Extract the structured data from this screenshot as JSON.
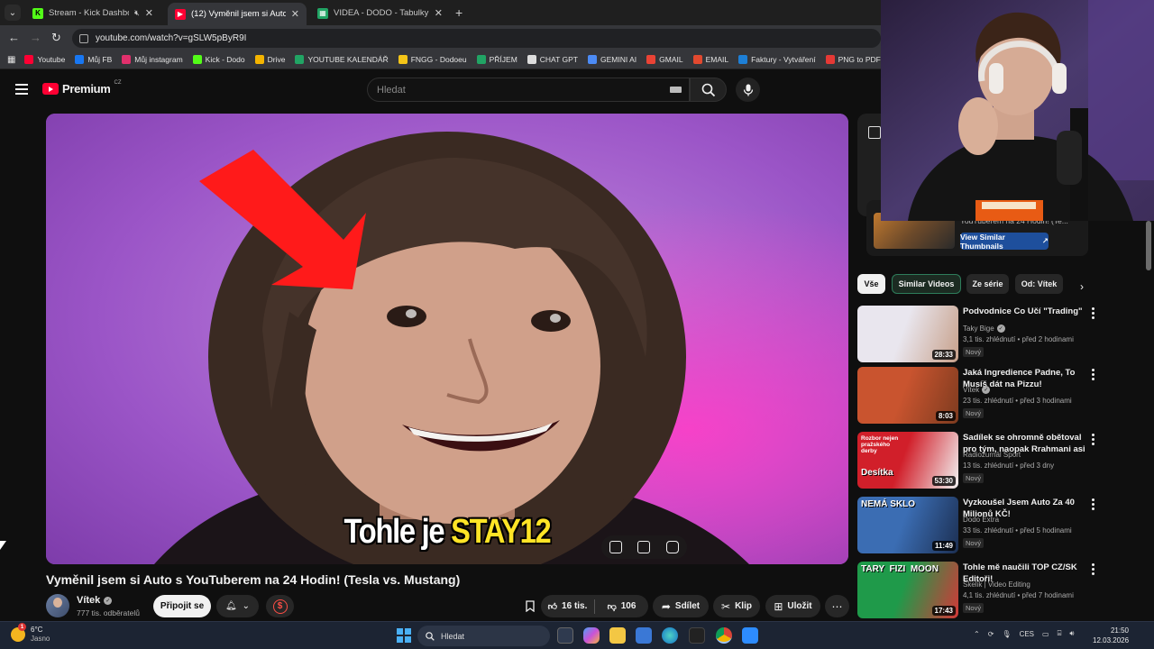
{
  "browser": {
    "tabs": [
      {
        "title": "Stream - Kick Dashboard",
        "favicon_color": "#53fc18",
        "muted": true
      },
      {
        "title": "(12) Vyměnil jsem si Auto s You",
        "favicon_color": "#ff0033",
        "active": true
      },
      {
        "title": "VIDEA - DODO - Tabulky Googl",
        "favicon_color": "#21a464"
      }
    ],
    "url": "youtube.com/watch?v=gSLW5pByR9I",
    "bookmarks": [
      {
        "label": "Youtube",
        "color": "#ff0033"
      },
      {
        "label": "Můj FB",
        "color": "#1877f2"
      },
      {
        "label": "Můj instagram",
        "color": "#e1306c"
      },
      {
        "label": "Kick - Dodo",
        "color": "#53fc18"
      },
      {
        "label": "Drive",
        "color": "#f4b400"
      },
      {
        "label": "YOUTUBE KALENDÁŘ",
        "color": "#21a464"
      },
      {
        "label": "FNGG - Dodoeu",
        "color": "#f5c518"
      },
      {
        "label": "PŘÍJEM",
        "color": "#21a464"
      },
      {
        "label": "CHAT GPT",
        "color": "#dddddd"
      },
      {
        "label": "GEMINI AI",
        "color": "#4c8bf5"
      },
      {
        "label": "GMAIL",
        "color": "#ea4335"
      },
      {
        "label": "EMAIL",
        "color": "#e2492f"
      },
      {
        "label": "Faktury - Vytváření",
        "color": "#1d7fd6"
      },
      {
        "label": "PNG to PDF",
        "color": "#e53935"
      }
    ]
  },
  "youtube": {
    "logo_text": "Premium",
    "logo_country": "CZ",
    "search_placeholder": "Hledat"
  },
  "video": {
    "caption_white": "Tohle je ",
    "caption_yellow": "STAY12",
    "title": "Vyměnil jsem si Auto s YouTuberem na 24 Hodin! (Tesla vs. Mustang)",
    "channel": "Vítek",
    "subscribers": "777 tis. odběratelů",
    "join_label": "Připojit se",
    "likes": "16 tis.",
    "dislikes": "106",
    "share_label": "Sdílet",
    "clip_label": "Klip",
    "save_label": "Uložit"
  },
  "side_card": {
    "title": "YouTuberem na 24 Hodin! (Te...",
    "button_label": "View Similar Thumbnails"
  },
  "chips": [
    "Vše",
    "Similar Videos",
    "Ze série",
    "Od: Vítek"
  ],
  "recommendations": [
    {
      "title": "Podvodnice Co Učí \"Trading\"",
      "channel": "Taky Bige",
      "verified": true,
      "meta": "3,1 tis. zhlédnutí • před 2 hodinami",
      "badge": "Nový",
      "duration": "28:33",
      "thumb_a": "#e9e6ee",
      "thumb_b": "#c7a08a"
    },
    {
      "title": "Jaká Ingredience Padne, To Musíš dát na Pizzu!",
      "channel": "Vítek",
      "verified": true,
      "meta": "23 tis. zhlédnutí • před 3 hodinami",
      "badge": "Nový",
      "duration": "8:03",
      "thumb_a": "#c9542f",
      "thumb_b": "#7d3b1f"
    },
    {
      "title": "Sadílek se ohromně obětoval pro tým, naopak Rrahmani asi ...",
      "channel": "Radiožurnál Sport",
      "verified": false,
      "meta": "13 tis. zhlédnutí • před 3 dny",
      "badge": "Nový",
      "duration": "53:30",
      "thumb_a": "#d11f2a",
      "thumb_b": "#f2f2f2",
      "thumb_text_top": "Rozbor nejen pražského derby",
      "thumb_text": "Desítka"
    },
    {
      "title": "Vyzkoušel Jsem Auto Za 40 Milionů KČ!",
      "channel": "Dodo Extra",
      "verified": false,
      "meta": "33 tis. zhlédnutí • před 5 hodinami",
      "badge": "Nový",
      "duration": "11:49",
      "thumb_a": "#3b6db3",
      "thumb_b": "#1c2f52",
      "thumb_text": "NEMÁ SKLO"
    },
    {
      "title": "Tohle mě naučili TOP CZ/SK Editoři!",
      "channel": "Skelik | Video Editing",
      "verified": false,
      "meta": "4,1 tis. zhlédnutí • před 7 hodinami",
      "badge": "Nový",
      "duration": "17:43",
      "thumb_a": "#1f9a4a",
      "thumb_b": "#d33838",
      "thumb_text": "TARY  FIZI  MOON"
    }
  ],
  "taskbar": {
    "temperature": "6°C",
    "weather": "Jasno",
    "notif_count": "1",
    "search_label": "Hledat",
    "lang": "CES",
    "time": "21:50",
    "date": "12.03.2026"
  }
}
